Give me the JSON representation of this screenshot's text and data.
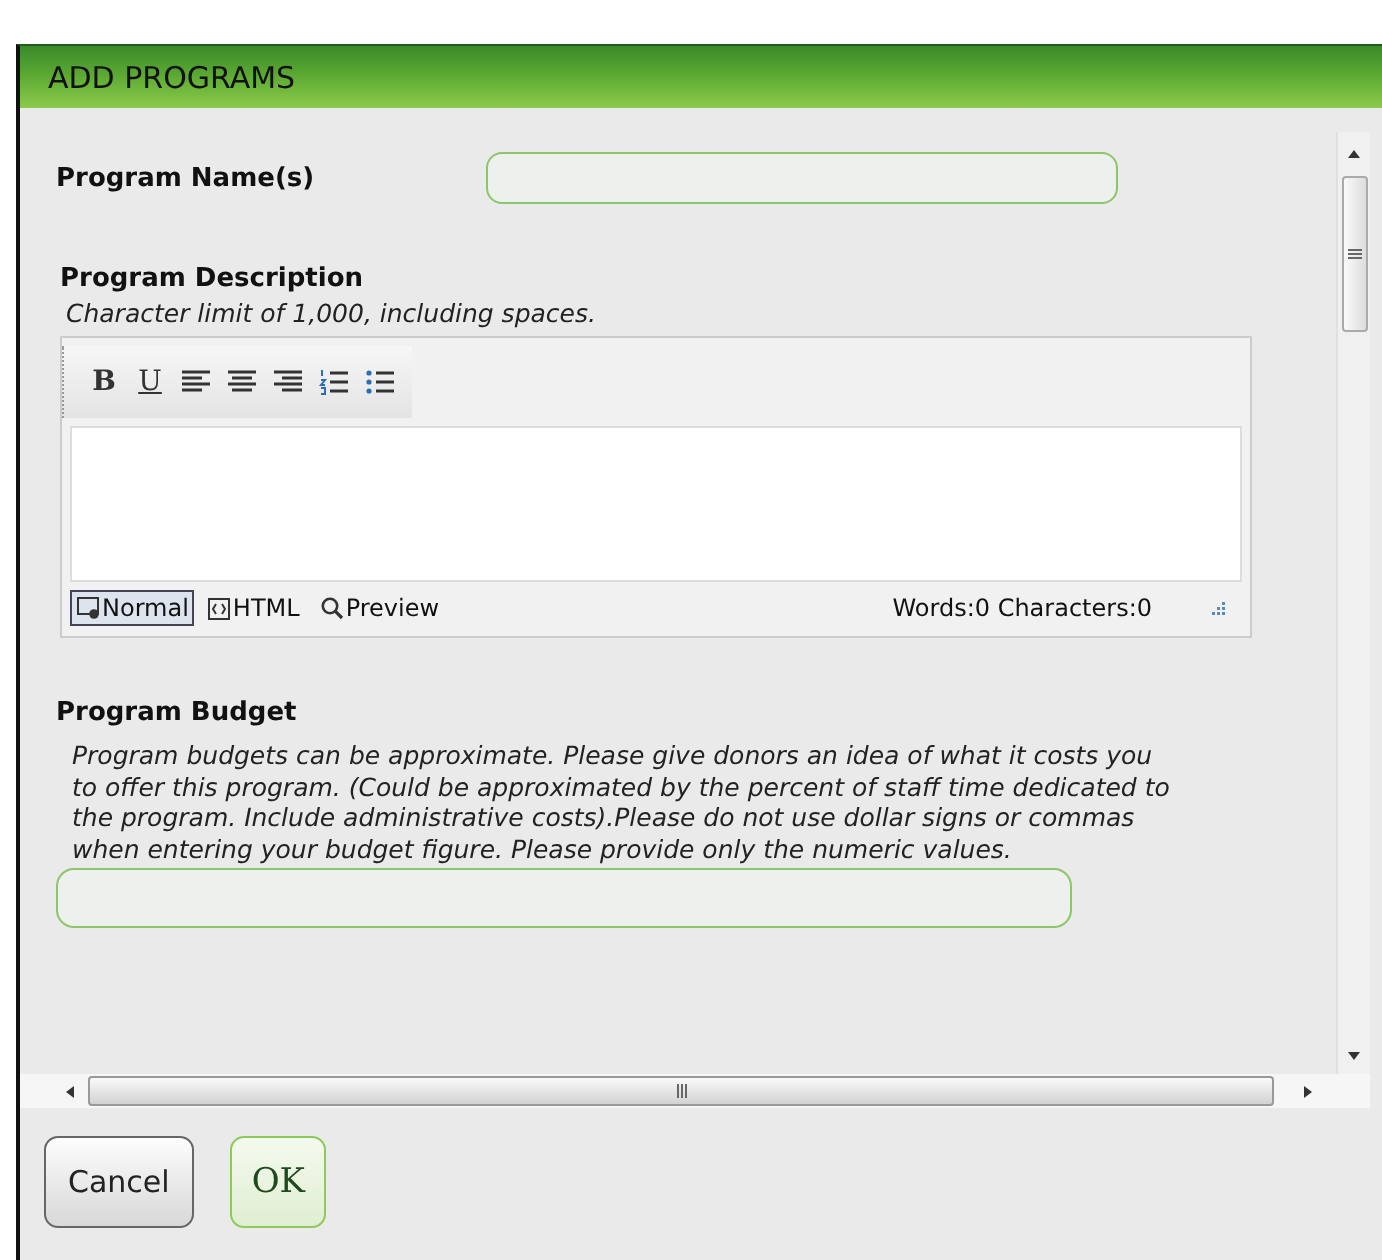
{
  "dialog": {
    "title": "ADD PROGRAMS"
  },
  "program_name": {
    "label": "Program Name(s)"
  },
  "program_description": {
    "label": "Program Description",
    "hint": "Character limit of 1,000, including spaces.",
    "toolbar": [
      {
        "kind": "bold",
        "label": "B"
      },
      {
        "kind": "underline",
        "label": "U"
      },
      {
        "kind": "align-left"
      },
      {
        "kind": "align-center"
      },
      {
        "kind": "align-right"
      },
      {
        "kind": "ordered-list"
      },
      {
        "kind": "bullet-list"
      }
    ],
    "modes": [
      {
        "label": "Normal",
        "kind": "normal",
        "selected": true
      },
      {
        "label": "HTML",
        "kind": "html",
        "selected": false
      },
      {
        "label": "Preview",
        "kind": "preview",
        "selected": false
      }
    ],
    "counter": "Words:0 Characters:0"
  },
  "program_budget": {
    "label": "Program Budget",
    "hint": "Program budgets can be approximate. Please give donors an idea of what it costs you to offer this program. (Could be approximated by the percent of staff time dedicated to the program. Include administrative costs).Please do not use dollar signs or commas when entering your budget figure. Please provide only the numeric values."
  },
  "buttons": [
    {
      "label": "Cancel",
      "kind": "default"
    },
    {
      "label": "OK",
      "kind": "primary"
    }
  ]
}
